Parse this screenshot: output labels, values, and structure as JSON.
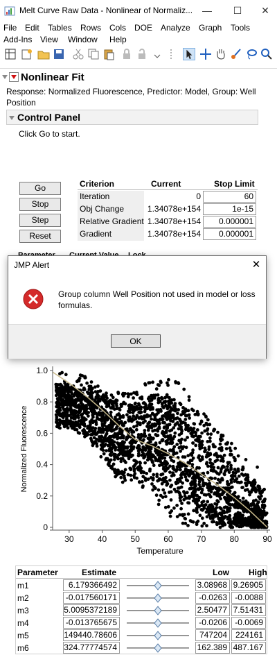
{
  "window": {
    "title": "Melt Curve Raw Data - Nonlinear of Normaliz...",
    "minimize": "—",
    "maximize": "☐",
    "close": "✕"
  },
  "menubar": {
    "row1": [
      "File",
      "Edit",
      "Tables",
      "Rows",
      "Cols",
      "DOE",
      "Analyze",
      "Graph",
      "Tools"
    ],
    "row2": [
      "Add-Ins",
      "View",
      "Window",
      "Help"
    ]
  },
  "toolbar": {
    "icons": [
      "new-table-icon",
      "open-icon",
      "folder-icon",
      "save-icon",
      "cut-icon",
      "copy-icon",
      "paste-icon",
      "lock-icon",
      "unlock-icon",
      "arrow-select-icon",
      "crosshair-icon",
      "hand-icon",
      "brush-icon",
      "lasso-icon",
      "magnifier-icon"
    ]
  },
  "report": {
    "title": "Nonlinear Fit",
    "response_line1": "Response: Normalized Fluorescence, Predictor: Model, Group: Well",
    "response_line2": "Position",
    "control_panel": "Control Panel",
    "click_go": "Click Go to start.",
    "buttons": {
      "go": "Go",
      "stop": "Stop",
      "step": "Step",
      "reset": "Reset"
    },
    "criterion": {
      "headers": [
        "Criterion",
        "Current",
        "Stop Limit"
      ],
      "rows": [
        {
          "name": "Iteration",
          "current": "0",
          "limit": "60"
        },
        {
          "name": "Obj Change",
          "current": "1.34078e+154",
          "limit": "1e-15"
        },
        {
          "name": "Relative Gradient",
          "current": "1.34078e+154",
          "limit": "0.000001"
        },
        {
          "name": "Gradient",
          "current": "1.34078e+154",
          "limit": "0.000001"
        }
      ]
    },
    "hidden_headers": [
      "Parameter",
      "Current Value",
      "Lock"
    ]
  },
  "dialog": {
    "title": "JMP Alert",
    "close": "✕",
    "message_line1": "Group column Well Position not used in model or loss",
    "message_line2": "formulas.",
    "ok": "OK",
    "icon": "error-icon"
  },
  "chart_data": {
    "type": "scatter",
    "xlabel": "Temperature",
    "ylabel": "Normalized Fluorescence",
    "xlim": [
      25,
      90
    ],
    "ylim": [
      0,
      1
    ],
    "xticks": [
      "30",
      "40",
      "50",
      "60",
      "70",
      "80",
      "90"
    ],
    "yticks": [
      "0",
      "0.2",
      "0.4",
      "0.6",
      "0.8",
      "1.0"
    ],
    "fit_line": {
      "x": [
        25,
        30,
        35,
        40,
        45,
        50,
        55,
        60,
        65,
        70,
        75,
        80,
        85,
        90
      ],
      "y": [
        0.99,
        0.92,
        0.84,
        0.75,
        0.65,
        0.56,
        0.52,
        0.47,
        0.41,
        0.34,
        0.27,
        0.19,
        0.1,
        0.0
      ]
    },
    "fit_color": "#c8b98a",
    "point_color": "#000000"
  },
  "parameters": {
    "headers": [
      "Parameter",
      "Estimate",
      "",
      "Low",
      "High"
    ],
    "rows": [
      {
        "name": "m1",
        "estimate": "6.179366492",
        "slider": 0.5,
        "low": "3.08968",
        "high": "9.26905"
      },
      {
        "name": "m2",
        "estimate": "-0.017560171",
        "slider": 0.5,
        "low": "-0.0263",
        "high": "-0.0088"
      },
      {
        "name": "m3",
        "estimate": "5.0095372189",
        "slider": 0.5,
        "low": "2.50477",
        "high": "7.51431"
      },
      {
        "name": "m4",
        "estimate": "-0.013765675",
        "slider": 0.5,
        "low": "-0.0206",
        "high": "-0.0069"
      },
      {
        "name": "m5",
        "estimate": "149440.78606",
        "slider": 0.5,
        "low": "747204",
        "high": "224161"
      },
      {
        "name": "m6",
        "estimate": "324.77774574",
        "slider": 0.5,
        "low": "162.389",
        "high": "487.167"
      }
    ]
  }
}
